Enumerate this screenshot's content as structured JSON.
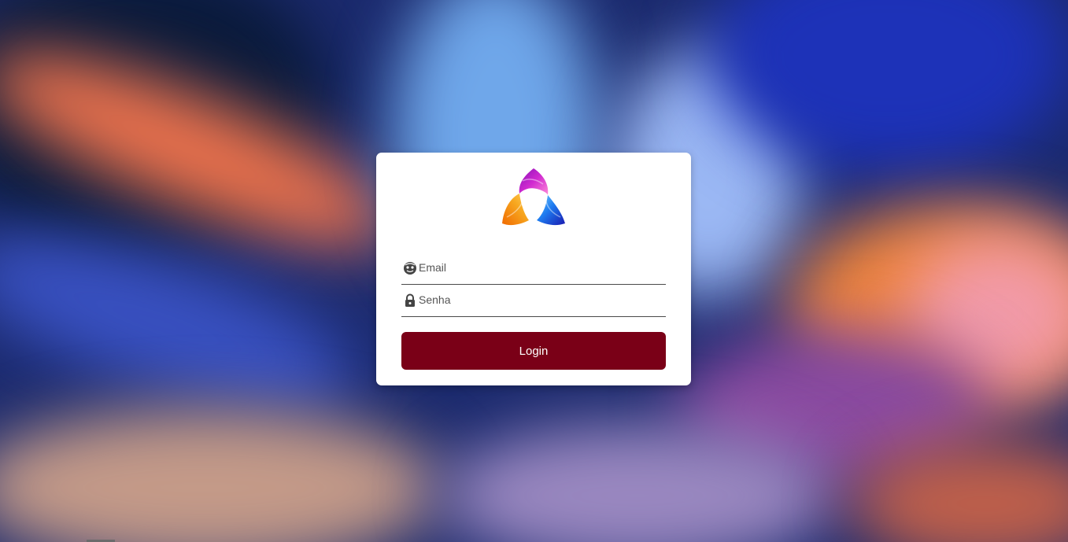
{
  "login_form": {
    "email_placeholder": "Email",
    "password_placeholder": "Senha",
    "login_label": "Login"
  },
  "icons": {
    "logo": "tri-petal-logo-icon",
    "email": "face-icon",
    "password": "lock-icon"
  },
  "colors": {
    "button": "#7a0017",
    "card": "#ffffff",
    "logo_top": "#c020c8",
    "logo_left": "#f59a10",
    "logo_right": "#1e6cf0"
  }
}
